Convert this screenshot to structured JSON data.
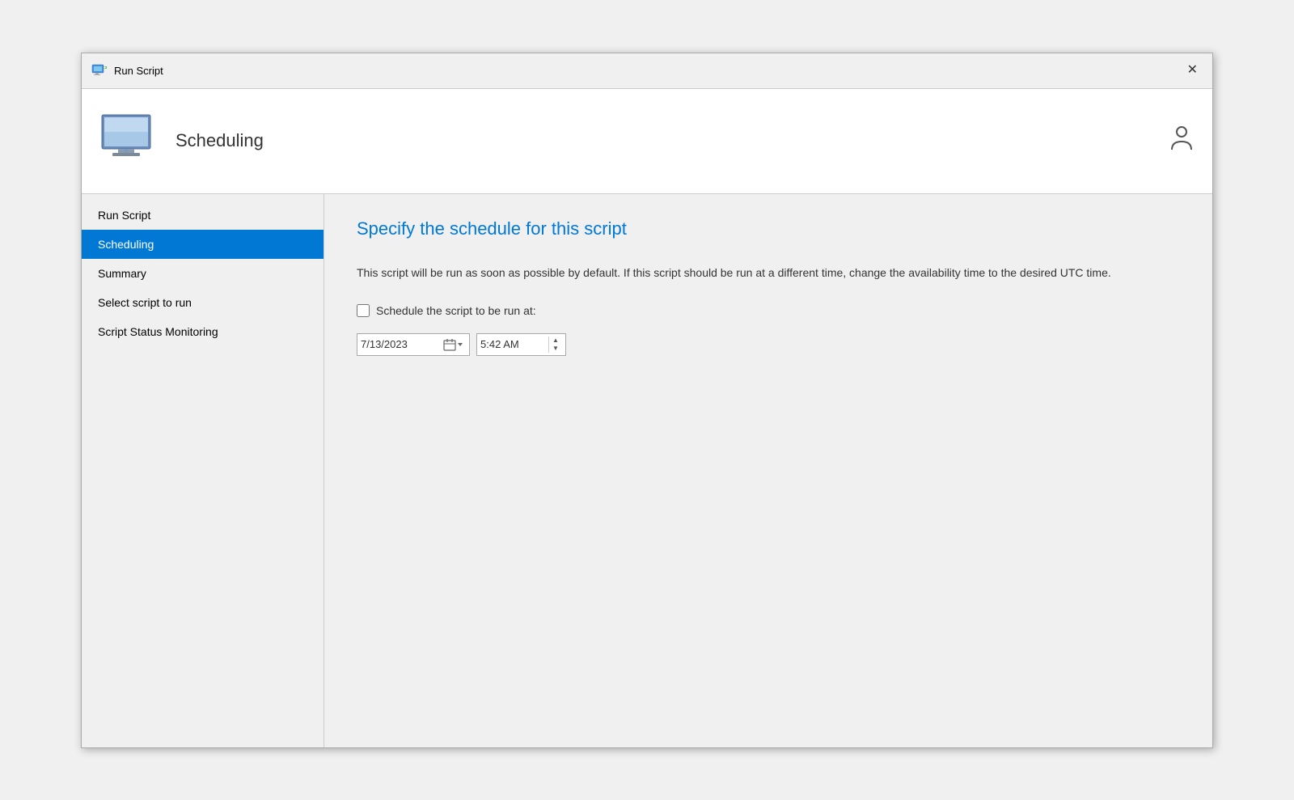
{
  "titleBar": {
    "title": "Run Script",
    "closeLabel": "✕"
  },
  "header": {
    "title": "Scheduling",
    "rightIconLabel": "👤"
  },
  "sidebar": {
    "items": [
      {
        "label": "Run Script",
        "active": false
      },
      {
        "label": "Scheduling",
        "active": true
      },
      {
        "label": "Summary",
        "active": false
      },
      {
        "label": "Select script to run",
        "active": false
      },
      {
        "label": "Script Status Monitoring",
        "active": false
      }
    ]
  },
  "content": {
    "title": "Specify the schedule for this script",
    "description": "This script will be run as soon as possible by default. If this script should be run at a different time, change the availability time to the desired UTC time.",
    "checkboxLabel": "Schedule the script to be run at:",
    "checkboxChecked": false,
    "dateValue": "7/13/2023",
    "timeValue": "5:42 AM"
  }
}
